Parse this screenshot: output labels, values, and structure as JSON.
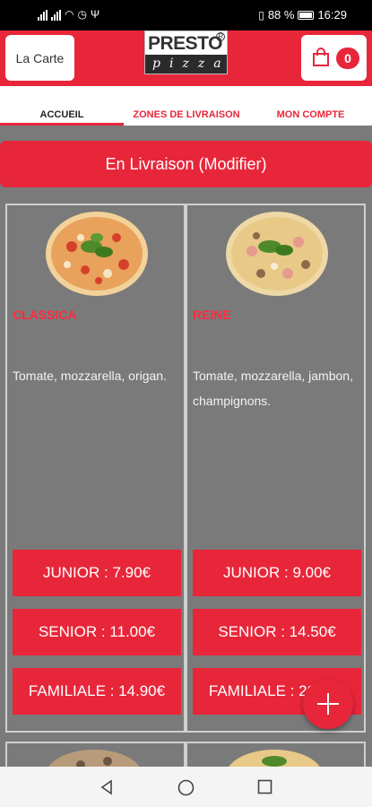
{
  "status_bar": {
    "battery": "88 %",
    "time": "16:29"
  },
  "header": {
    "carte_label": "La Carte",
    "cart_count": "0",
    "logo_top": "PRESTO",
    "logo_bottom": "pizza",
    "logo_mark": "R"
  },
  "tabs": [
    {
      "label": "ACCUEIL"
    },
    {
      "label": "ZONES DE LIVRAISON"
    },
    {
      "label": "MON COMPTE"
    }
  ],
  "delivery_label": "En Livraison (Modifier)",
  "products": [
    {
      "name": "CLASSICA",
      "description": "Tomate, mozzarella, origan.",
      "prices": [
        "JUNIOR : 7.90€",
        "SENIOR : 11.00€",
        "FAMILIALE : 14.90€"
      ]
    },
    {
      "name": "REINE",
      "description": "Tomate, mozzarella, jambon, champignons.",
      "prices": [
        "JUNIOR : 9.00€",
        "SENIOR : 14.50€",
        "FAMILIALE : 20.00€"
      ]
    }
  ],
  "colors": {
    "brand_red": "#e8263a",
    "background": "#7a7a7a"
  }
}
